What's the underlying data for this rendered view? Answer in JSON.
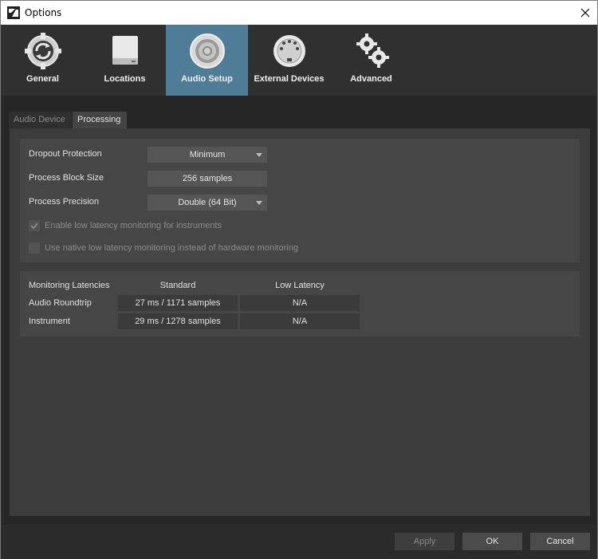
{
  "window": {
    "title": "Options"
  },
  "categories": [
    {
      "label": "General",
      "icon": "sync-gear-icon"
    },
    {
      "label": "Locations",
      "icon": "drive-icon"
    },
    {
      "label": "Audio Setup",
      "icon": "speaker-icon",
      "active": true
    },
    {
      "label": "External Devices",
      "icon": "midi-connector-icon"
    },
    {
      "label": "Advanced",
      "icon": "gears-icon"
    }
  ],
  "subtabs": [
    {
      "label": "Audio Device"
    },
    {
      "label": "Processing",
      "active": true
    }
  ],
  "processing": {
    "dropout_label": "Dropout Protection",
    "dropout_value": "Minimum",
    "block_label": "Process Block Size",
    "block_value": "256 samples",
    "precision_label": "Process Precision",
    "precision_value": "Double (64 Bit)",
    "low_latency_instruments_label": "Enable low latency monitoring for instruments",
    "low_latency_instruments_checked": true,
    "native_low_latency_label": "Use native low latency monitoring instead of hardware monitoring",
    "native_low_latency_checked": false
  },
  "latencies": {
    "header": "Monitoring Latencies",
    "col_standard": "Standard",
    "col_low": "Low Latency",
    "rows": [
      {
        "name": "Audio Roundtrip",
        "standard": "27 ms / 1171 samples",
        "low": "N/A"
      },
      {
        "name": "Instrument",
        "standard": "29 ms / 1278 samples",
        "low": "N/A"
      }
    ]
  },
  "buttons": {
    "apply": "Apply",
    "ok": "OK",
    "cancel": "Cancel"
  },
  "colors": {
    "accent": "#4f7d98",
    "background": "#2b2b2b",
    "panel": "#3c3c3c"
  }
}
